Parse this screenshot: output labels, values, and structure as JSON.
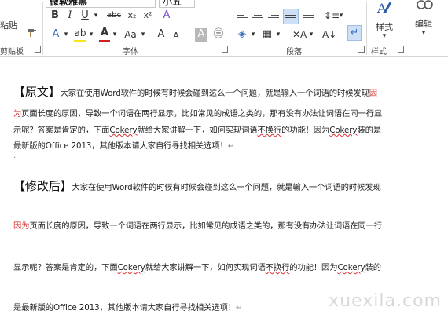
{
  "ribbon": {
    "paste_label": "粘贴",
    "font_name": "微软雅黑",
    "font_size": "小五",
    "groups": {
      "clipboard": "剪贴板",
      "font": "字体",
      "paragraph": "段落",
      "styles": "样式"
    },
    "styles_label": "样式",
    "edit_label": "编辑",
    "font_tools": {
      "bold": "B",
      "italic": "I",
      "underline": "U",
      "strike": "abc",
      "subscript": "x₂",
      "superscript": "x²",
      "clear": "A",
      "grow": "Aᐞ",
      "case": "Aa",
      "font_color": "A",
      "grow2": "A",
      "shrink2": "A",
      "shade": "A",
      "enclose": "㊂"
    },
    "colors": {
      "highlight": "#f5e51b",
      "font_color": "#d21f1f",
      "selected": "#cde0f5"
    }
  },
  "document": {
    "original": {
      "heading": "【原文】",
      "line1_a": "大家在使用Word软件的时候有时候会碰到这么一个问题，就是输入一个词语的时候发现",
      "line1_red": "因",
      "line2_red": "为",
      "line2_a": "页面长度的原因，导致一个词语在两行显示，比如常见的成语之类的，那有没有办法让词语在同一行显",
      "line3_a": "示呢？答案是肯定的，下面",
      "line3_cokery": "Cokery",
      "line3_b": "就给大家讲解一下，如何实现词语",
      "line3_wrap": "不换行",
      "line3_c": "的功能！因为",
      "line3_cokery2": "Cokery",
      "line3_d": "装的是",
      "line4": "最新版的Office 2013，其他版本请大家自行寻找相关选项！",
      "mark": "↵"
    },
    "revised": {
      "heading": "【修改后】",
      "line1": "大家在使用Word软件的时候有时候会碰到这么一个问题，就是输入一个词语的时候发现",
      "line2_red": "因为",
      "line2": "页面长度的原因，导致一个词语在两行显示，比如常见的成语之类的，那有没有办法让词语在同一行",
      "line3_a": "显示呢？答案是肯定的，下面",
      "line3_cokery": "Cokery",
      "line3_b": "就给大家讲解一下，如何实现词语",
      "line3_wrap": "不换行",
      "line3_c": "的功能！因为",
      "line3_cokery2": "Cokery",
      "line3_d": "装的",
      "line4": "是最新版的Office 2013，其他版本请大家自行寻找相关选项！",
      "mark": "↵"
    },
    "empty_mark": ".",
    "watermark": "xuexila.com"
  }
}
